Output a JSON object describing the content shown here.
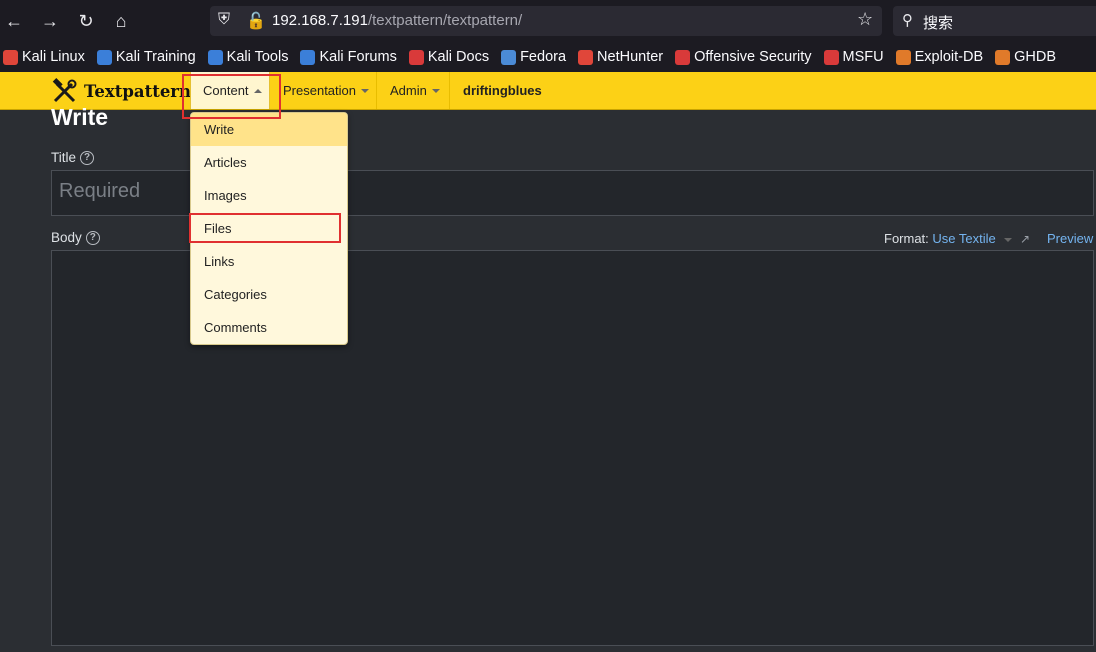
{
  "browser": {
    "url_host": "192.168.7.191",
    "url_path": "/textpattern/textpattern/",
    "search_placeholder": "搜索",
    "bookmarks": [
      {
        "label": "Kali Linux",
        "color": "#e0463a"
      },
      {
        "label": "Kali Training",
        "color": "#3b7fd9"
      },
      {
        "label": "Kali Tools",
        "color": "#3b7fd9"
      },
      {
        "label": "Kali Forums",
        "color": "#3b7fd9"
      },
      {
        "label": "Kali Docs",
        "color": "#d93a3a"
      },
      {
        "label": "Fedora",
        "color": "#4b8bd6"
      },
      {
        "label": "NetHunter",
        "color": "#e0463a"
      },
      {
        "label": "Offensive Security",
        "color": "#d93a3a"
      },
      {
        "label": "MSFU",
        "color": "#d93a3a"
      },
      {
        "label": "Exploit-DB",
        "color": "#e07a2a"
      },
      {
        "label": "GHDB",
        "color": "#e07a2a"
      }
    ]
  },
  "app": {
    "logo_text": "Textpattern",
    "nav": {
      "content": "Content",
      "presentation": "Presentation",
      "admin": "Admin"
    },
    "user": "driftingblues"
  },
  "page": {
    "title": "Write",
    "title_label": "Title",
    "title_placeholder": "Required",
    "body_label": "Body",
    "format_label": "Format:",
    "format_value": "Use Textile",
    "preview": "Preview"
  },
  "dropdown": {
    "items": [
      "Write",
      "Articles",
      "Images",
      "Files",
      "Links",
      "Categories",
      "Comments"
    ]
  },
  "colors": {
    "accent_yellow": "#fcd116",
    "link_blue": "#74b4f0",
    "annotation_red": "#e03030"
  }
}
